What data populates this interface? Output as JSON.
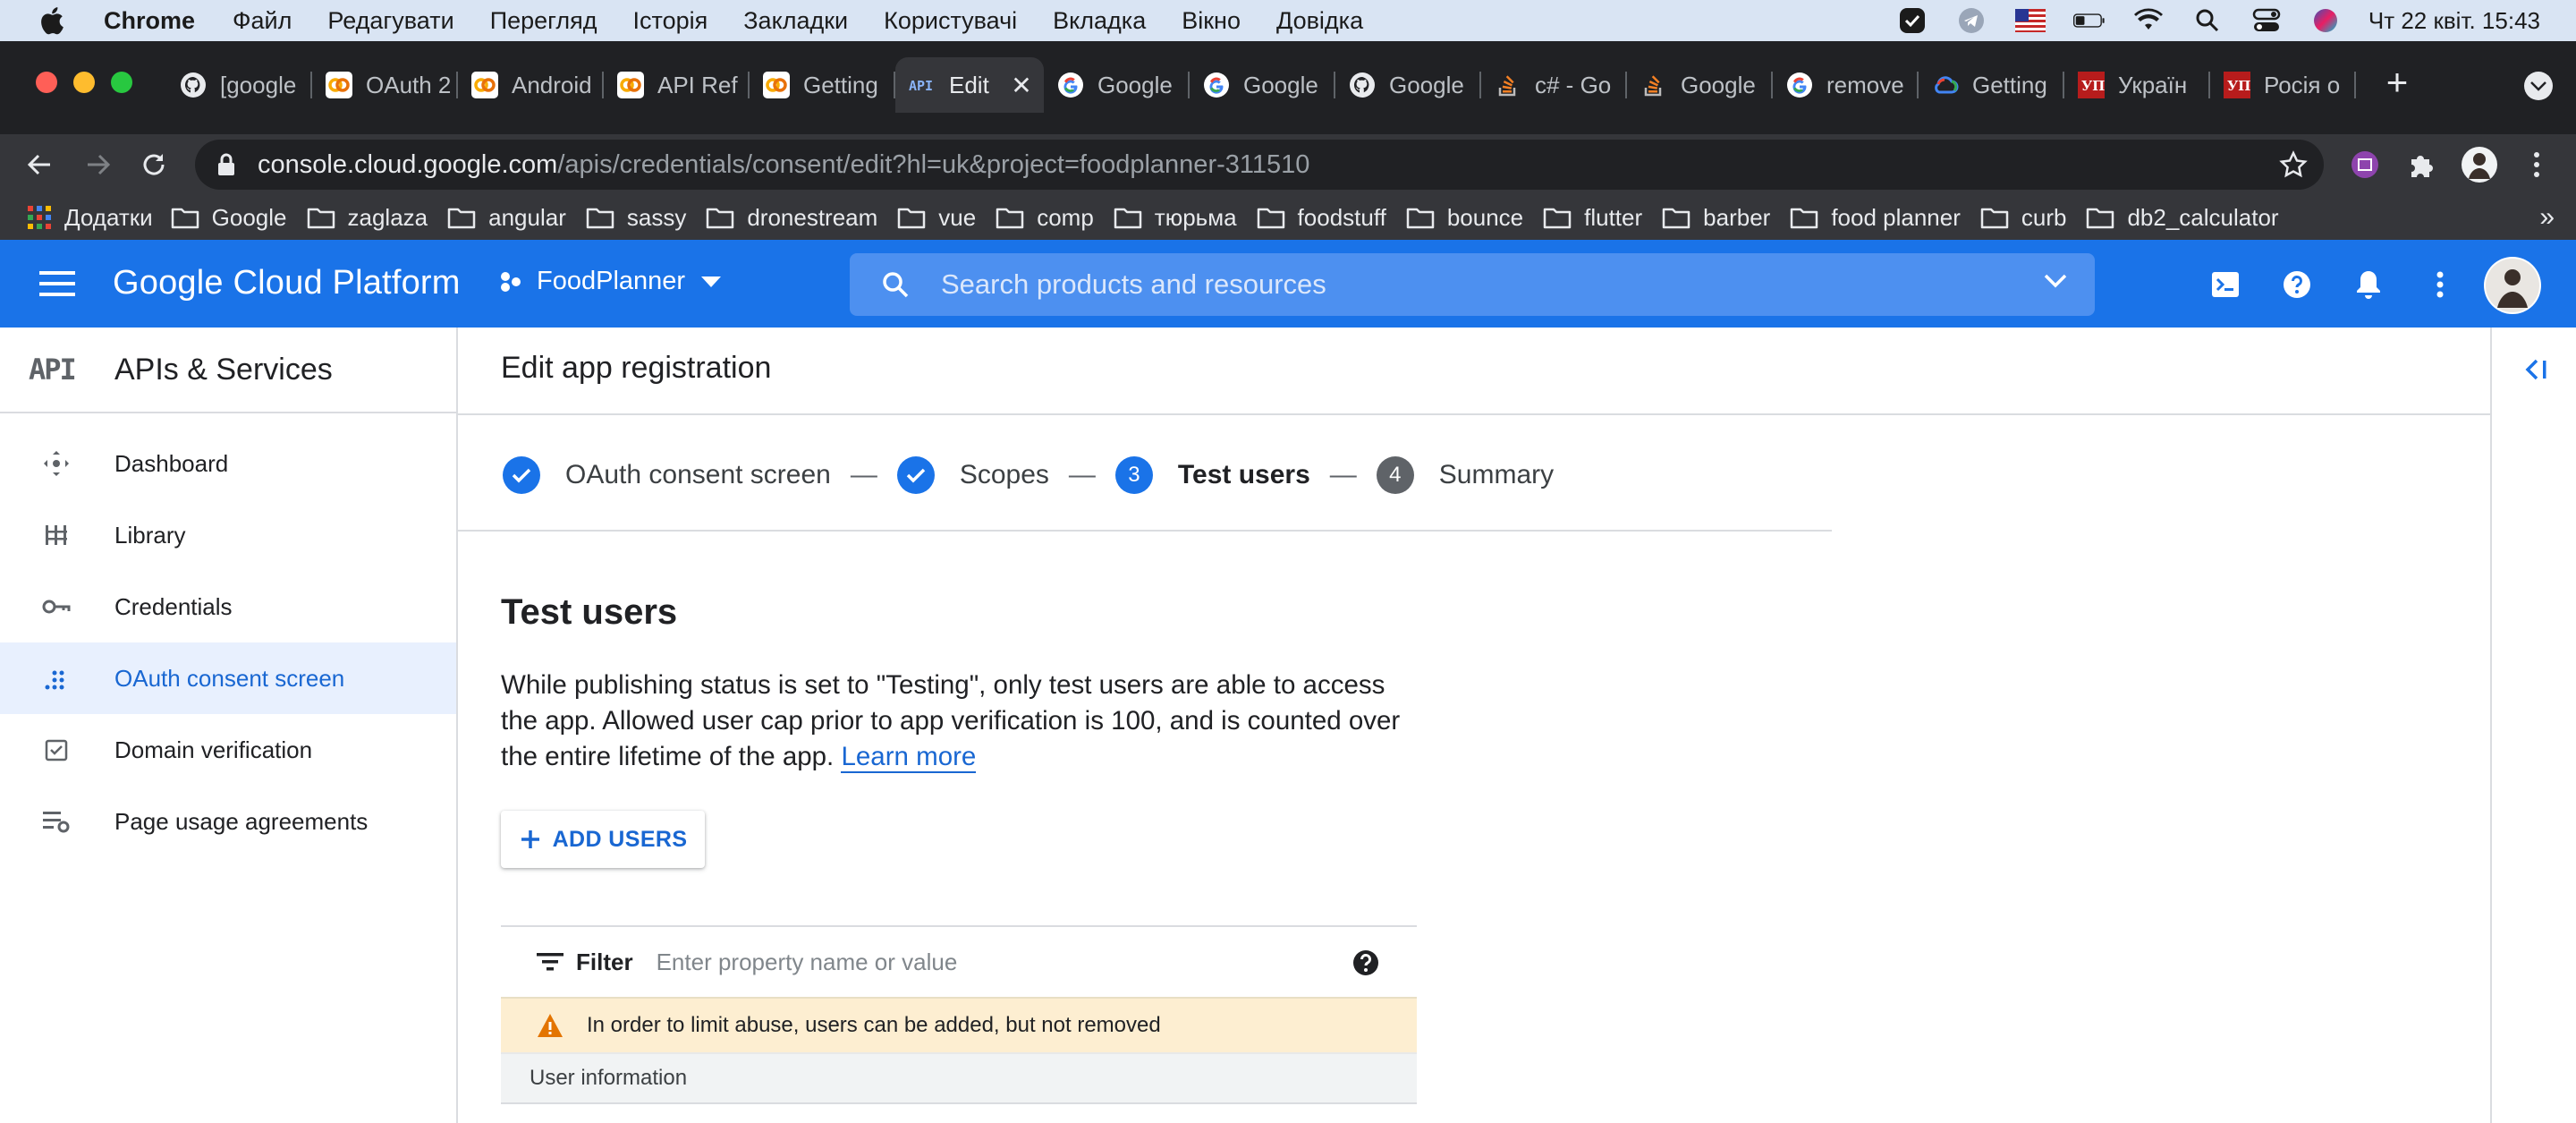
{
  "menubar": {
    "app": "Chrome",
    "items": [
      "Файл",
      "Редагувати",
      "Перегляд",
      "Історія",
      "Закладки",
      "Користувачі",
      "Вкладка",
      "Вікно",
      "Довідка"
    ],
    "datetime": "Чт 22 квіт.  15:43"
  },
  "tabs": [
    {
      "label": "[google",
      "icon": "github-icon"
    },
    {
      "label": "OAuth 2",
      "icon": "colab-icon"
    },
    {
      "label": "Android",
      "icon": "colab-icon"
    },
    {
      "label": "API Ref",
      "icon": "colab-icon"
    },
    {
      "label": "Getting",
      "icon": "colab-icon"
    },
    {
      "label": "Edit",
      "icon": "api-icon",
      "active": true
    },
    {
      "label": "Google",
      "icon": "google-icon"
    },
    {
      "label": "Google",
      "icon": "google-icon"
    },
    {
      "label": "Google",
      "icon": "github-icon"
    },
    {
      "label": "c# - Go",
      "icon": "stackoverflow-icon"
    },
    {
      "label": "Google",
      "icon": "stackoverflow-icon"
    },
    {
      "label": "remove",
      "icon": "google-icon"
    },
    {
      "label": "Getting",
      "icon": "cloud-icon"
    },
    {
      "label": "Україн",
      "icon": "up-news-icon"
    },
    {
      "label": "Росія о",
      "icon": "up-news-icon"
    }
  ],
  "omnibox": {
    "host": "console.cloud.google.com",
    "path": "/apis/credentials/consent/edit?hl=uk&project=foodplanner-311510"
  },
  "bookmarks": {
    "apps": "Додатки",
    "folders": [
      "Google",
      "zaglaza",
      "angular",
      "sassy",
      "dronestream",
      "vue",
      "comp",
      "тюрьма",
      "foodstuff",
      "bounce",
      "flutter",
      "barber",
      "food planner",
      "curb",
      "db2_calculator"
    ],
    "more": "»"
  },
  "gcp": {
    "title": "Google Cloud Platform",
    "project": "FoodPlanner",
    "search_placeholder": "Search products and resources"
  },
  "leftnav": {
    "badge": "API",
    "title": "APIs & Services",
    "items": [
      {
        "label": "Dashboard",
        "icon": "dashboard-icon"
      },
      {
        "label": "Library",
        "icon": "library-icon"
      },
      {
        "label": "Credentials",
        "icon": "key-icon"
      },
      {
        "label": "OAuth consent screen",
        "icon": "consent-icon",
        "selected": true
      },
      {
        "label": "Domain verification",
        "icon": "checkbox-icon"
      },
      {
        "label": "Page usage agreements",
        "icon": "settings-list-icon"
      }
    ]
  },
  "main": {
    "page_title": "Edit app registration",
    "steps": [
      {
        "label": "OAuth consent screen",
        "state": "done"
      },
      {
        "label": "Scopes",
        "state": "done"
      },
      {
        "label": "Test users",
        "state": "current",
        "number": "3"
      },
      {
        "label": "Summary",
        "state": "todo",
        "number": "4"
      }
    ],
    "separator": "—",
    "section_title": "Test users",
    "description": "While publishing status is set to \"Testing\", only test users are able to access the app. Allowed user cap prior to app verification is 100, and is counted over the entire lifetime of the app.",
    "learn_more": "Learn more",
    "add_users": "ADD USERS",
    "filter_label": "Filter",
    "filter_placeholder": "Enter property name or value",
    "warning": "In order to limit abuse, users can be added, but not removed",
    "column_header": "User information"
  },
  "colors": {
    "gcp_blue": "#1a73e8",
    "link_blue": "#1967d2",
    "warning_bg": "#fdeed1",
    "warning_icon": "#e37400"
  }
}
